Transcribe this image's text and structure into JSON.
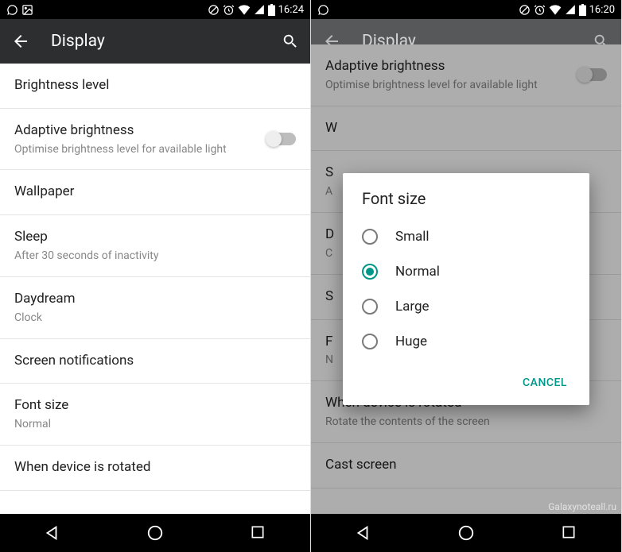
{
  "left": {
    "status": {
      "time": "16:24"
    },
    "toolbar": {
      "title": "Display"
    },
    "items": [
      {
        "title": "Brightness level",
        "sub": ""
      },
      {
        "title": "Adaptive brightness",
        "sub": "Optimise brightness level for available light",
        "switch": true
      },
      {
        "title": "Wallpaper",
        "sub": ""
      },
      {
        "title": "Sleep",
        "sub": "After 30 seconds of inactivity"
      },
      {
        "title": "Daydream",
        "sub": "Clock"
      },
      {
        "title": "Screen notifications",
        "sub": ""
      },
      {
        "title": "Font size",
        "sub": "Normal"
      },
      {
        "title": "When device is rotated",
        "sub": ""
      }
    ]
  },
  "right": {
    "status": {
      "time": "16:20"
    },
    "toolbar": {
      "title": "Display"
    },
    "bg_items": [
      {
        "title": "Adaptive brightness",
        "sub": "Optimise brightness level for available light",
        "switch": true
      },
      {
        "title": "W",
        "sub": ""
      },
      {
        "title": "S",
        "sub": "A"
      },
      {
        "title": "D",
        "sub": "C"
      },
      {
        "title": "S",
        "sub": ""
      },
      {
        "title": "F",
        "sub": "N"
      },
      {
        "title": "When device is rotated",
        "sub": "Rotate the contents of the screen"
      },
      {
        "title": "Cast screen",
        "sub": ""
      }
    ],
    "dialog": {
      "title": "Font size",
      "options": [
        {
          "label": "Small",
          "checked": false
        },
        {
          "label": "Normal",
          "checked": true
        },
        {
          "label": "Large",
          "checked": false
        },
        {
          "label": "Huge",
          "checked": false
        }
      ],
      "cancel": "CANCEL"
    }
  },
  "watermark": "Galaxynoteall.ru"
}
